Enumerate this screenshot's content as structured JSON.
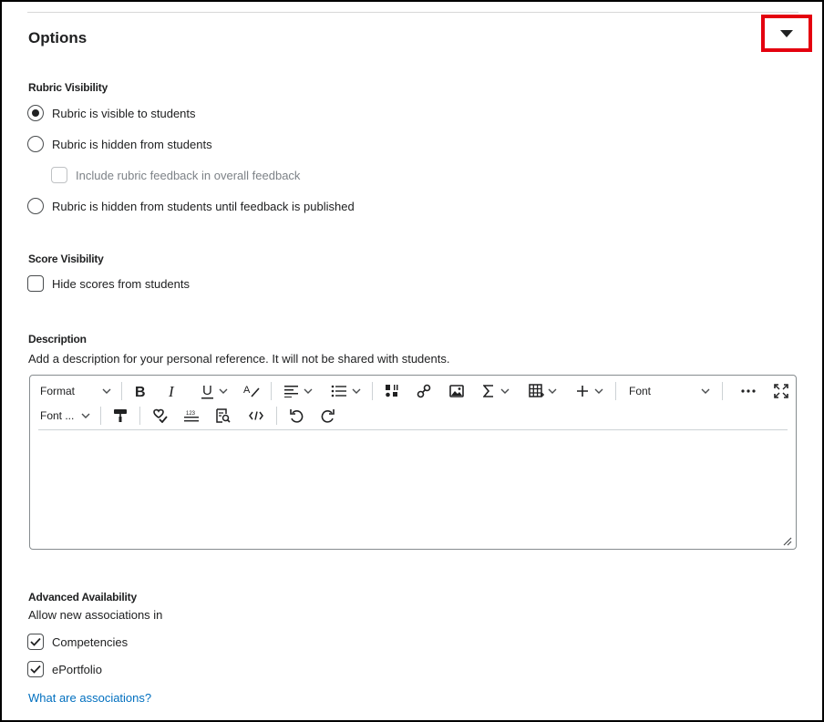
{
  "panel": {
    "title": "Options"
  },
  "rubric_visibility": {
    "label": "Rubric Visibility",
    "options": [
      {
        "label": "Rubric is visible to students",
        "checked": true
      },
      {
        "label": "Rubric is hidden from students",
        "checked": false
      },
      {
        "label": "Rubric is hidden from students until feedback is published",
        "checked": false
      }
    ],
    "include_feedback": {
      "label": "Include rubric feedback in overall feedback",
      "checked": false,
      "disabled": true
    }
  },
  "score_visibility": {
    "label": "Score Visibility",
    "hide_scores": {
      "label": "Hide scores from students",
      "checked": false
    }
  },
  "description": {
    "label": "Description",
    "help": "Add a description for your personal reference. It will not be shared with students.",
    "toolbar": {
      "format_label": "Format",
      "font_label": "Font",
      "font_size_label": "Font ..."
    },
    "content": ""
  },
  "advanced_availability": {
    "label": "Advanced Availability",
    "subtitle": "Allow new associations in",
    "items": [
      {
        "label": "Competencies",
        "checked": true
      },
      {
        "label": "ePortfolio",
        "checked": true
      }
    ],
    "help_link": "What are associations?"
  },
  "colors": {
    "accent_highlight": "#e4000f",
    "link": "#006fbf",
    "text": "#202122"
  }
}
